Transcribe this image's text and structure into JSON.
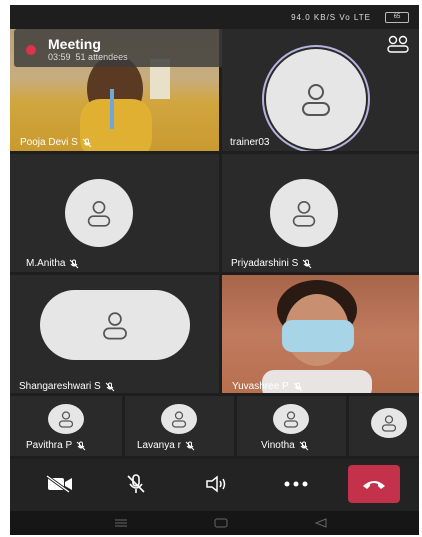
{
  "status_bar": {
    "text": "94.0 KB/S  Vo  LTE  ",
    "battery": "65"
  },
  "meeting": {
    "title": "Meeting",
    "timer": "03:59",
    "attendees": "51 attendees"
  },
  "tiles": [
    {
      "name": "Pooja Devi S"
    },
    {
      "name": "trainer03"
    },
    {
      "name": "M.Anitha"
    },
    {
      "name": "Priyadarshini S"
    },
    {
      "name": "Shangareshwari S"
    },
    {
      "name": "Yuvashree P"
    }
  ],
  "strip": [
    {
      "name": "Pavithra P"
    },
    {
      "name": "Lavanya r"
    },
    {
      "name": "Vinotha"
    }
  ],
  "icons": {
    "participants": "people-icon",
    "video": "video-off-icon",
    "mic": "mic-off-icon",
    "speaker": "speaker-icon",
    "more": "more-icon",
    "hangup": "hang-up-icon"
  },
  "colors": {
    "recording": "#e0324b",
    "hangup": "#c4314b",
    "background": "#1e1e1e"
  }
}
